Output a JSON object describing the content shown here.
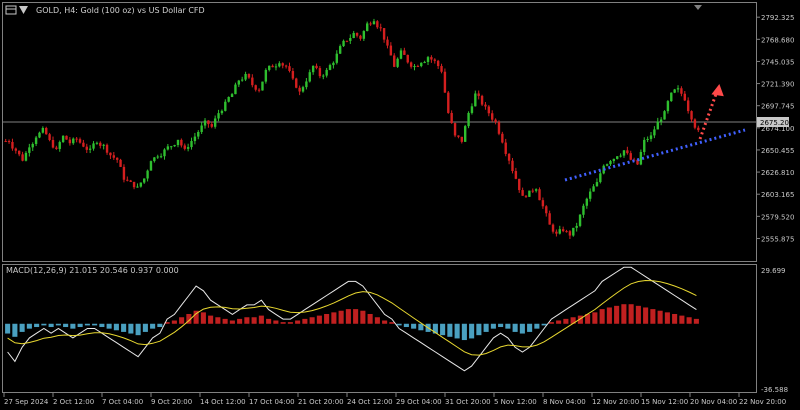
{
  "header": {
    "symbol_title": "GOLD, H4:  Gold (100 oz) vs US Dollar CFD"
  },
  "indicator": {
    "label": "MACD(12,26,9) 21.015 20.546 0.937 0.000"
  },
  "colors": {
    "background": "#000000",
    "bull_candle": "#2fbf2f",
    "bear_candle": "#d41f1f",
    "grid_border": "#808080",
    "trendline": "#4060ff",
    "arrow": "#ff4a4a",
    "macd_line": "#e8e8e8",
    "signal_line": "#e8d830",
    "hist_pos": "#c02020",
    "hist_neg": "#4aa0c0",
    "current_price_line": "#808080"
  },
  "chart_data": [
    {
      "type": "candlestick",
      "title": "GOLD, H4:  Gold (100 oz) vs US Dollar CFD",
      "ylim": [
        2535,
        2800
      ],
      "y_ticks": [
        "2792.325",
        "2768.680",
        "2745.035",
        "2721.390",
        "2697.745",
        "2674.100",
        "2650.455",
        "2626.810",
        "2603.165",
        "2579.520",
        "2555.875"
      ],
      "current_price": "2675.200",
      "x_ticks": [
        "27 Sep 2024",
        "2 Oct 12:00",
        "7 Oct 04:00",
        "9 Oct 20:00",
        "14 Oct 12:00",
        "17 Oct 04:00",
        "21 Oct 20:00",
        "24 Oct 12:00",
        "29 Oct 04:00",
        "31 Oct 20:00",
        "5 Nov 12:00",
        "8 Nov 04:00",
        "12 Nov 20:00",
        "15 Nov 12:00",
        "20 Nov 04:00",
        "22 Nov 20:00"
      ],
      "close_path": [
        2660,
        2650,
        2640,
        2655,
        2665,
        2672,
        2660,
        2650,
        2665,
        2658,
        2662,
        2655,
        2650,
        2660,
        2655,
        2645,
        2640,
        2620,
        2615,
        2610,
        2620,
        2640,
        2645,
        2650,
        2655,
        2662,
        2650,
        2660,
        2670,
        2680,
        2675,
        2690,
        2700,
        2710,
        2725,
        2730,
        2720,
        2715,
        2735,
        2740,
        2745,
        2740,
        2725,
        2712,
        2725,
        2740,
        2730,
        2735,
        2745,
        2760,
        2768,
        2775,
        2770,
        2785,
        2790,
        2780,
        2760,
        2740,
        2755,
        2745,
        2740,
        2745,
        2750,
        2745,
        2735,
        2690,
        2665,
        2660,
        2690,
        2710,
        2700,
        2690,
        2680,
        2660,
        2640,
        2620,
        2600,
        2605,
        2610,
        2590,
        2570,
        2560,
        2565,
        2560,
        2570,
        2590,
        2605,
        2615,
        2635,
        2640,
        2645,
        2650,
        2640,
        2635,
        2660,
        2665,
        2680,
        2690,
        2710,
        2715,
        2705,
        2685,
        2670
      ]
    },
    {
      "type": "macd",
      "name": "MACD(12,26,9)",
      "values": {
        "main": "21.015",
        "signal": "20.546",
        "histogram": "0.937",
        "extra": "0.000"
      },
      "ylim": [
        -36.588,
        29.699
      ],
      "y_ticks": [
        "29.699",
        "-36.588"
      ],
      "histogram": [
        -6,
        -8,
        -5,
        -3,
        -2,
        -1,
        -2,
        -1,
        -2,
        -3,
        -2,
        -1,
        -1,
        -2,
        -3,
        -4,
        -5,
        -6,
        -7,
        -5,
        -3,
        -2,
        1,
        2,
        4,
        6,
        8,
        7,
        5,
        4,
        3,
        2,
        3,
        4,
        4,
        5,
        3,
        2,
        1,
        1,
        2,
        3,
        4,
        5,
        6,
        7,
        8,
        9,
        9,
        8,
        6,
        4,
        2,
        1,
        -1,
        -2,
        -3,
        -4,
        -5,
        -6,
        -7,
        -8,
        -9,
        -10,
        -9,
        -7,
        -5,
        -3,
        -2,
        -3,
        -5,
        -6,
        -5,
        -3,
        -1,
        1,
        2,
        3,
        4,
        5,
        6,
        7,
        9,
        10,
        11,
        12,
        12,
        11,
        10,
        9,
        8,
        7,
        6,
        5,
        4,
        3
      ]
    }
  ]
}
